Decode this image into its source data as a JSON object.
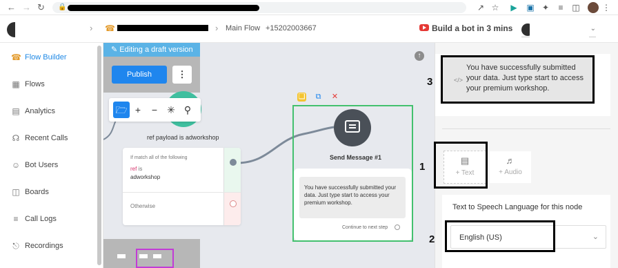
{
  "header": {
    "crumb_flow": "Main Flow",
    "phone": "+15202003667",
    "build_link": "Build a bot in 3 mins"
  },
  "sidebar": {
    "items": [
      {
        "label": "Flow Builder",
        "icon": "flow-icon"
      },
      {
        "label": "Flows",
        "icon": "grid-icon"
      },
      {
        "label": "Analytics",
        "icon": "chart-icon"
      },
      {
        "label": "Recent Calls",
        "icon": "headset-icon"
      },
      {
        "label": "Bot Users",
        "icon": "user-icon"
      },
      {
        "label": "Boards",
        "icon": "board-icon"
      },
      {
        "label": "Call Logs",
        "icon": "layers-icon"
      },
      {
        "label": "Recordings",
        "icon": "mic-icon"
      }
    ]
  },
  "canvas": {
    "draft_banner": "Editing a draft version",
    "publish_label": "Publish",
    "condition_title": "ref payload is adworkshop",
    "condition": {
      "match_text": "If match all of the following",
      "field": "ref",
      "operator": "is",
      "value": "adworkshop",
      "otherwise": "Otherwise"
    },
    "send_title": "Send Message #1",
    "message": "You have successfully submitted your data. Just type start to access your premium workshop.",
    "continue_label": "Continue to next step"
  },
  "right_panel": {
    "message": "You have successfully submitted your data. Just type start to access your premium workshop.",
    "add_text": "+ Text",
    "add_audio": "+ Audio",
    "tts_label": "Text to Speech Language for this node",
    "language": "English (US)"
  },
  "annotations": [
    "3",
    "1",
    "2"
  ],
  "colors": {
    "accent": "#1f86ee",
    "draft_banner": "#5bb3e6",
    "frame_green": "#43c06e",
    "minimap_frame": "#c23bd6"
  }
}
